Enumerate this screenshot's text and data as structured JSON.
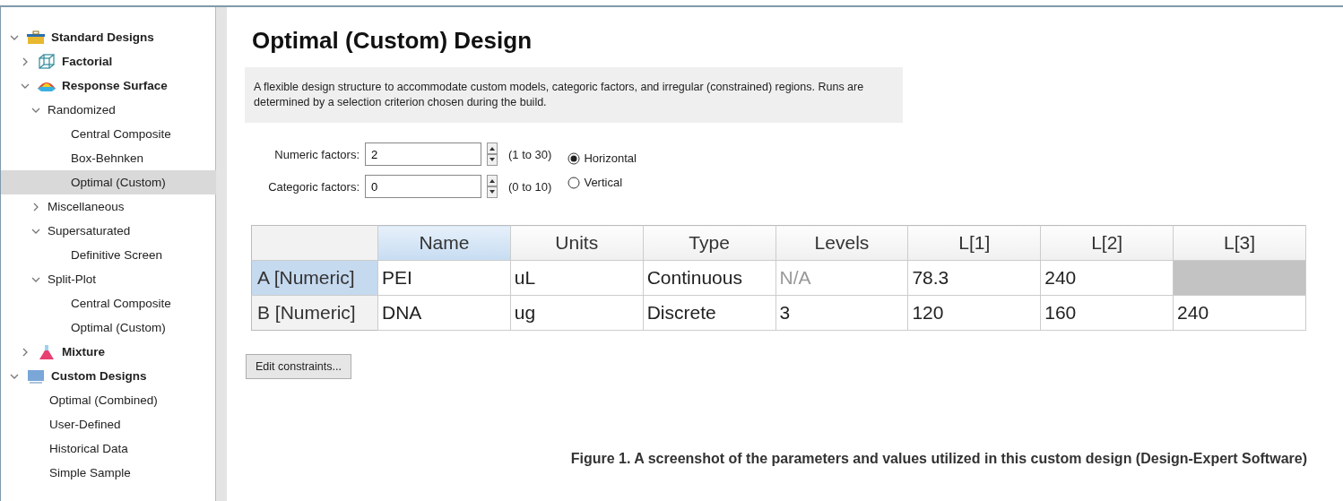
{
  "tree": [
    {
      "label": "Standard Designs",
      "kind": "toolbox",
      "expanded": true,
      "selected": false,
      "children": [
        {
          "label": "Factorial",
          "kind": "cube",
          "expanded": false,
          "selected": false
        },
        {
          "label": "Response Surface",
          "kind": "surface",
          "expanded": true,
          "selected": false,
          "children": [
            {
              "label": "Randomized",
              "kind": "folder",
              "expanded": true,
              "selected": false,
              "children": [
                {
                  "label": "Central Composite",
                  "kind": "design",
                  "selected": false
                },
                {
                  "label": "Box-Behnken",
                  "kind": "design",
                  "selected": false
                },
                {
                  "label": "Optimal (Custom)",
                  "kind": "design",
                  "selected": true
                }
              ]
            },
            {
              "label": "Miscellaneous",
              "kind": "folder",
              "expanded": false,
              "selected": false
            },
            {
              "label": "Supersaturated",
              "kind": "folder",
              "expanded": true,
              "selected": false,
              "children": [
                {
                  "label": "Definitive Screen",
                  "kind": "design",
                  "selected": false
                }
              ]
            },
            {
              "label": "Split-Plot",
              "kind": "folder",
              "expanded": true,
              "selected": false,
              "children": [
                {
                  "label": "Central Composite",
                  "kind": "design",
                  "selected": false
                },
                {
                  "label": "Optimal (Custom)",
                  "kind": "design",
                  "selected": false
                }
              ]
            }
          ]
        },
        {
          "label": "Mixture",
          "kind": "flask",
          "expanded": false,
          "selected": false
        }
      ]
    },
    {
      "label": "Custom Designs",
      "kind": "monitor",
      "expanded": true,
      "selected": false,
      "children": [
        {
          "label": "Optimal (Combined)",
          "kind": "design",
          "selected": false
        },
        {
          "label": "User-Defined",
          "kind": "design",
          "selected": false
        },
        {
          "label": "Historical Data",
          "kind": "design",
          "selected": false
        },
        {
          "label": "Simple Sample",
          "kind": "design",
          "selected": false
        }
      ]
    }
  ],
  "title": "Optimal (Custom) Design",
  "description": "A flexible design structure to accommodate custom models, categoric factors, and irregular (constrained) regions. Runs are determined by a selection criterion chosen during the build.",
  "factors": [
    {
      "label": "Numeric factors:",
      "value": "2",
      "range": "(1 to 30)"
    },
    {
      "label": "Categoric factors:",
      "value": "0",
      "range": "(0 to 10)"
    }
  ],
  "orientation": [
    {
      "label": "Horizontal",
      "selected": true
    },
    {
      "label": "Vertical",
      "selected": false
    }
  ],
  "table": {
    "columns": [
      {
        "label": "Name",
        "selected": true
      },
      {
        "label": "Units",
        "selected": false
      },
      {
        "label": "Type",
        "selected": false
      },
      {
        "label": "Levels",
        "selected": false
      },
      {
        "label": "L[1]",
        "selected": false
      },
      {
        "label": "L[2]",
        "selected": false
      },
      {
        "label": "L[3]",
        "selected": false
      }
    ],
    "rows": [
      {
        "header": "A [Numeric]",
        "selected": true,
        "cells": [
          {
            "text": "PEI",
            "disabled": false
          },
          {
            "text": "uL",
            "disabled": false
          },
          {
            "text": "Continuous",
            "disabled": false
          },
          {
            "text": "N/A",
            "disabled": true
          },
          {
            "text": "78.3",
            "disabled": false
          },
          {
            "text": "240",
            "disabled": false
          },
          {
            "disabled": true
          }
        ]
      },
      {
        "header": "B [Numeric]",
        "selected": false,
        "cells": [
          {
            "text": "DNA",
            "disabled": false
          },
          {
            "text": "ug",
            "disabled": false
          },
          {
            "text": "Discrete",
            "disabled": false
          },
          {
            "text": "3",
            "disabled": false
          },
          {
            "text": "120",
            "disabled": false
          },
          {
            "text": "160",
            "disabled": false
          },
          {
            "text": "240",
            "disabled": false
          }
        ]
      }
    ]
  },
  "button": "Edit constraints...",
  "caption": "Figure 1. A screenshot of the parameters and values utilized in this custom design (Design-Expert Software)"
}
